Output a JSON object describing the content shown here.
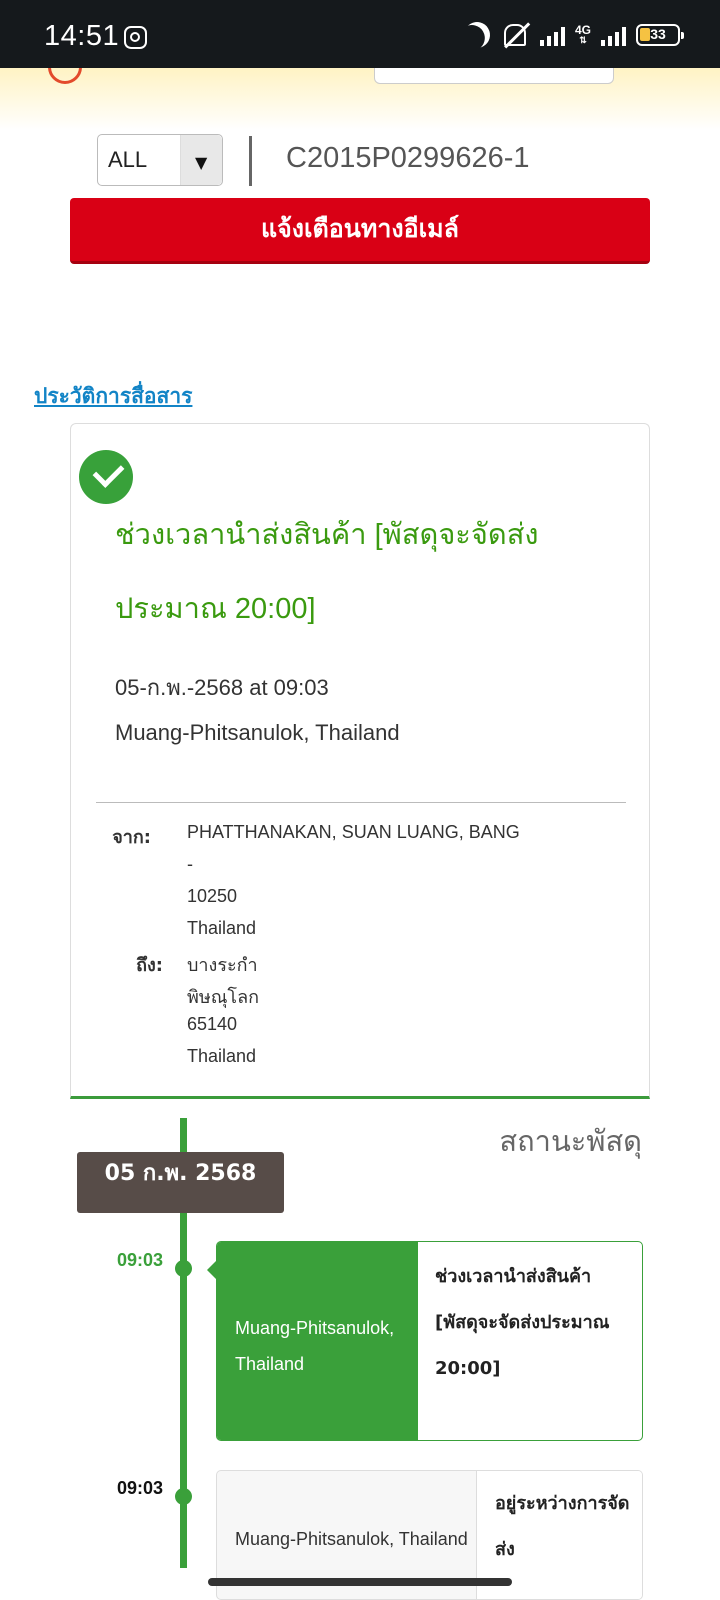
{
  "status_bar": {
    "time": "14:51",
    "network": "4G",
    "battery": "33"
  },
  "search": {
    "filter_selected": "ALL",
    "tracking_number": "C2015P0299626-1"
  },
  "email_button_label": "แจ้งเตือนทางอีเมล์",
  "history_link": "ประวัติการสื่อสาร",
  "summary": {
    "status_title": "ช่วงเวลานำส่งสินค้า [พัสดุจะจัดส่งประมาณ 20:00]",
    "datetime": "05-ก.พ.-2568 at 09:03",
    "location": "Muang-Phitsanulok, Thailand",
    "from_label": "จาก:",
    "from_lines": [
      "PHATTHANAKAN, SUAN LUANG, BANG",
      "-",
      "10250",
      "Thailand"
    ],
    "to_label": "ถึง:",
    "to_lines": [
      "บางระกำ",
      "พิษณุโลก",
      "65140",
      "Thailand"
    ]
  },
  "timeline": {
    "title": "สถานะพัสดุ",
    "date": "05 ก.พ. 2568",
    "events": [
      {
        "time": "09:03",
        "location": "Muang-Phitsanulok, Thailand",
        "status": "ช่วงเวลานำส่งสินค้า [พัสดุจะจัดส่งประมาณ 20:00]"
      },
      {
        "time": "09:03",
        "location": "Muang-Phitsanulok, Thailand",
        "status": "อยู่ระหว่างการจัดส่ง"
      }
    ]
  },
  "colors": {
    "accent_red": "#d90015",
    "accent_green": "#3aa03a",
    "link_blue": "#1284c6"
  }
}
